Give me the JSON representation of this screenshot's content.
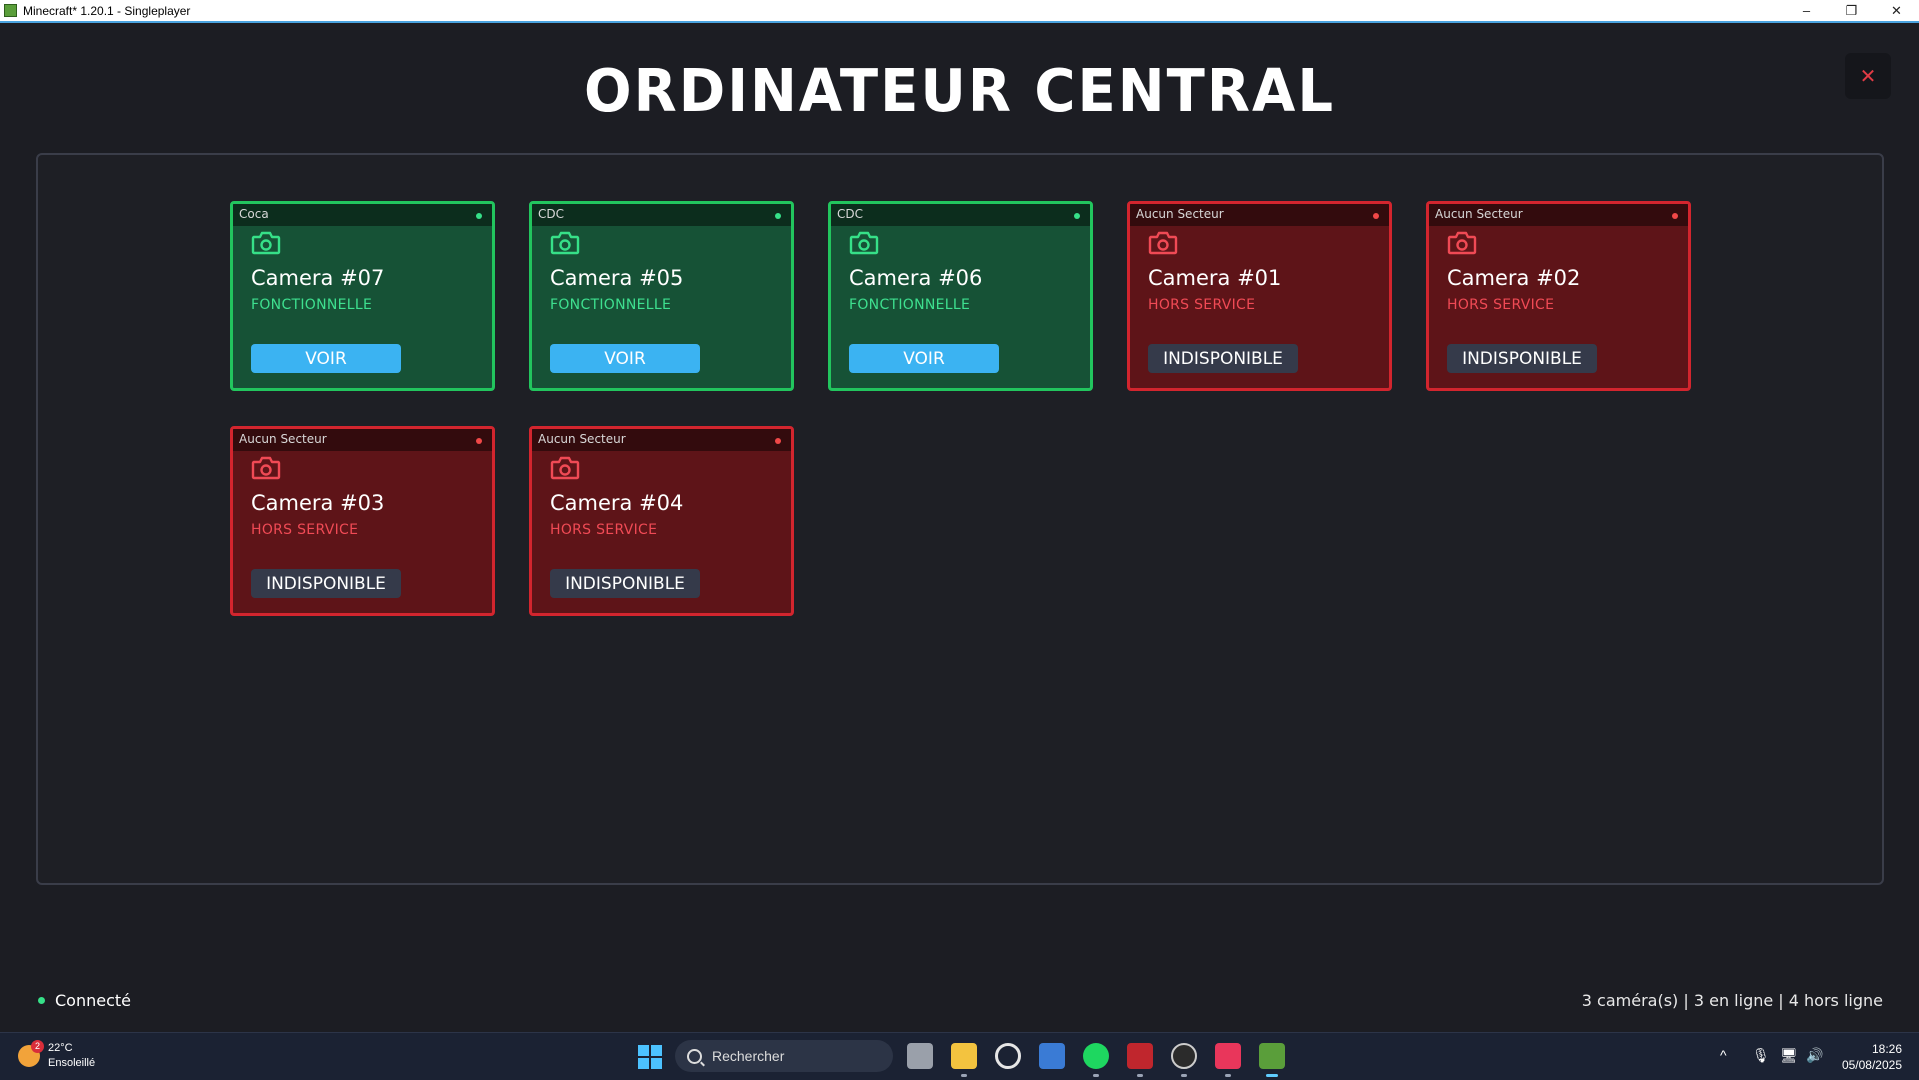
{
  "window": {
    "title": "Minecraft* 1.20.1 - Singleplayer",
    "controls": {
      "minimize": "–",
      "restore": "❐",
      "close": "✕"
    }
  },
  "page": {
    "title": "ORDINATEUR CENTRAL",
    "close_label": "✕"
  },
  "colors": {
    "ok_bg": "#165236",
    "ok_border": "#22c55e",
    "off_bg": "#5e1418",
    "off_border": "#d3252e",
    "voir_button": "#3bb3f2"
  },
  "cameras": [
    {
      "sector": "Coca",
      "name": "Camera #07",
      "status": "FONCTIONNELLE",
      "action": "VOIR",
      "online": true
    },
    {
      "sector": "CDC",
      "name": "Camera #05",
      "status": "FONCTIONNELLE",
      "action": "VOIR",
      "online": true
    },
    {
      "sector": "CDC",
      "name": "Camera #06",
      "status": "FONCTIONNELLE",
      "action": "VOIR",
      "online": true
    },
    {
      "sector": "Aucun Secteur",
      "name": "Camera #01",
      "status": "HORS SERVICE",
      "action": "INDISPONIBLE",
      "online": false
    },
    {
      "sector": "Aucun Secteur",
      "name": "Camera #02",
      "status": "HORS SERVICE",
      "action": "INDISPONIBLE",
      "online": false
    },
    {
      "sector": "Aucun Secteur",
      "name": "Camera #03",
      "status": "HORS SERVICE",
      "action": "INDISPONIBLE",
      "online": false
    },
    {
      "sector": "Aucun Secteur",
      "name": "Camera #04",
      "status": "HORS SERVICE",
      "action": "INDISPONIBLE",
      "online": false
    }
  ],
  "footer": {
    "connection": "Connecté",
    "stats": "3 caméra(s) | 3 en ligne | 4 hors ligne"
  },
  "taskbar": {
    "weather_temp": "22°C",
    "weather_desc": "Ensoleillé",
    "weather_badge": "2",
    "search_placeholder": "Rechercher",
    "time": "18:26",
    "date": "05/08/2025",
    "apps": [
      "task-view",
      "file-explorer",
      "github",
      "microsoft-store",
      "spotify",
      "voicemeeter",
      "obs",
      "intellij",
      "minecraft"
    ]
  }
}
